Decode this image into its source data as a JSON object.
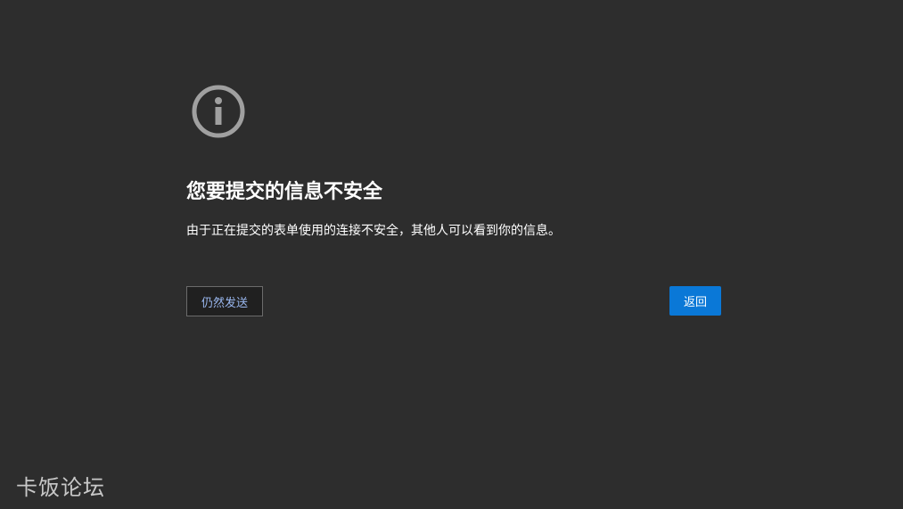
{
  "icon": {
    "name": "info-icon",
    "color": "#a0a0a0"
  },
  "heading": {
    "title": "您要提交的信息不安全"
  },
  "message": {
    "text": "由于正在提交的表单使用的连接不安全，其他人可以看到你的信息。"
  },
  "actions": {
    "send_anyway_label": "仍然发送",
    "back_label": "返回"
  },
  "watermark": {
    "text": "卡饭论坛"
  },
  "colors": {
    "background": "#2d2d2d",
    "primary_button": "#0a78d7",
    "secondary_button_text": "#9ab8f0"
  }
}
